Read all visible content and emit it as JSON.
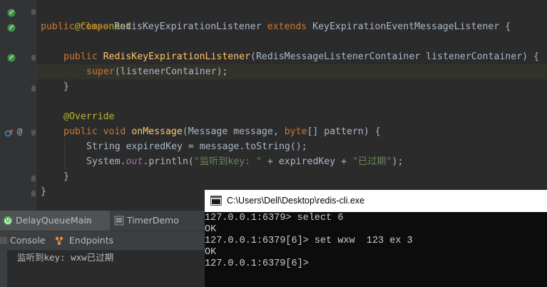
{
  "editor": {
    "lines": [
      {
        "annotation": "@Component"
      },
      {
        "kw1": "public",
        "kw2": "class",
        "name": "RedisKeyExpirationListener",
        "kw3": "extends",
        "parent": "KeyExpirationEventMessageListener",
        "brace": "{"
      },
      {},
      {
        "kw": "public",
        "ctor": "RedisKeyExpirationListener",
        "params": "(RedisMessageListenerContainer listenerContainer) {"
      },
      {
        "kw": "super",
        "rest": "(listenerContainer);"
      },
      {
        "brace": "}"
      },
      {},
      {
        "annotation": "@Override"
      },
      {
        "kw1": "public",
        "kw2": "void",
        "method": "onMessage",
        "params": "(Message message, ",
        "kw3": "byte",
        "rest": "[] pattern) {"
      },
      {
        "text": "String expiredKey = message.toString();"
      },
      {
        "prefix": "System.",
        "field": "out",
        "mid": ".println(",
        "str1": "\"监听到key: \"",
        "concat": " + expiredKey + ",
        "str2": "\"已过期\"",
        "end": ");"
      },
      {
        "brace": "}"
      },
      {
        "brace": "}"
      }
    ]
  },
  "toolwindow": {
    "run_tabs": [
      {
        "label": "DelayQueueMain",
        "icon": "spring-boot-icon",
        "active": true
      },
      {
        "label": "TimerDemo",
        "icon": "java-class-icon",
        "active": false
      }
    ],
    "subtabs": [
      {
        "label": "Console",
        "icon": "console-icon"
      },
      {
        "label": "Endpoints",
        "icon": "endpoints-icon"
      }
    ],
    "console_output": "监听到key: wxw已过期"
  },
  "cmd_window": {
    "title": "C:\\Users\\Dell\\Desktop\\redis-cli.exe",
    "lines": [
      "127.0.0.1:6379> select 6",
      "OK",
      "127.0.0.1:6379[6]> set wxw  123 ex 3",
      "OK",
      "127.0.0.1:6379[6]>"
    ]
  },
  "colors": {
    "editor_bg": "#2b2b2b",
    "keyword": "#cc7832",
    "annotation": "#bbb529",
    "function": "#ffc66d",
    "string": "#6a8759",
    "field": "#9876aa",
    "text": "#a9b7c6",
    "cmd_bg": "#0c0c0c",
    "cmd_text": "#cccccc"
  }
}
